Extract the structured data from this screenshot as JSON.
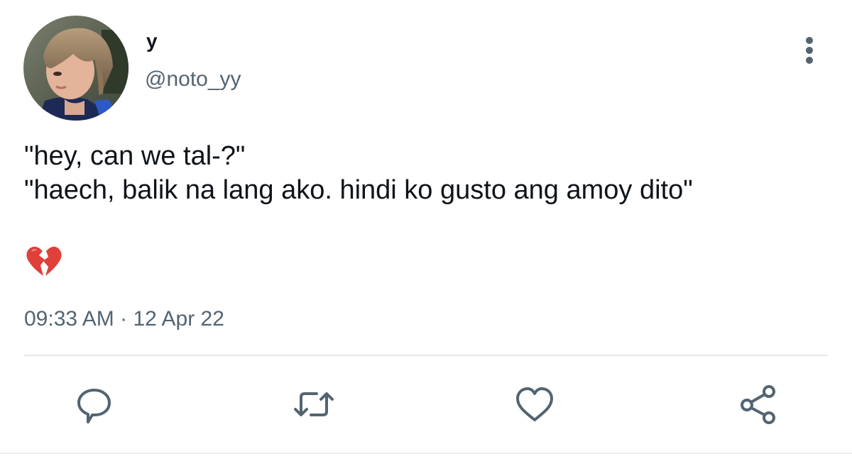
{
  "profile": {
    "display_name": "y",
    "handle": "@noto_yy"
  },
  "tweet": {
    "lines": [
      "\"hey, can we tal-?\"",
      "\"haech, balik na lang ako. hindi ko gusto ang amoy dito\""
    ],
    "emoji": "broken-heart",
    "time": "09:33 AM",
    "separator": "·",
    "date": "12 Apr 22"
  },
  "actions": [
    {
      "name": "reply",
      "icon": "speech-bubble-icon"
    },
    {
      "name": "retweet",
      "icon": "retweet-icon"
    },
    {
      "name": "like",
      "icon": "heart-icon"
    },
    {
      "name": "share",
      "icon": "share-icon"
    }
  ],
  "colors": {
    "text_primary": "#0f1419",
    "text_secondary": "#536471",
    "icon": "#536471",
    "divider": "#e6e9ec",
    "emoji_red": "#e0403a"
  }
}
